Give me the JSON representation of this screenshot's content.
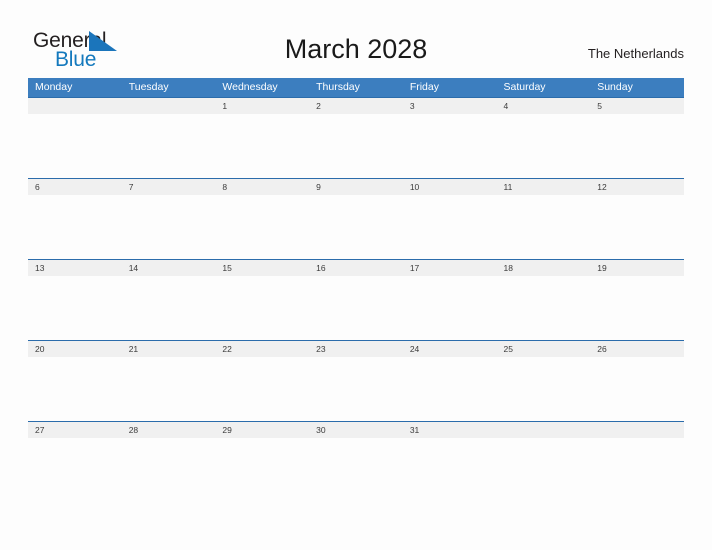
{
  "brand": {
    "word_one": "General",
    "word_two": "Blue",
    "triangle_icon": "triangle-icon",
    "accent_color": "#1b75bb"
  },
  "header": {
    "title": "March 2028",
    "region": "The Netherlands"
  },
  "theme": {
    "header_blue": "#3c7ebf",
    "row_line_blue": "#2b6cab",
    "date_band_gray": "#f0f0f0",
    "page_background": "#fdfdfd",
    "text_dark": "#231f20"
  },
  "calendar": {
    "weekday_headers": [
      "Monday",
      "Tuesday",
      "Wednesday",
      "Thursday",
      "Friday",
      "Saturday",
      "Sunday"
    ],
    "weeks": [
      [
        "",
        "",
        "1",
        "2",
        "3",
        "4",
        "5"
      ],
      [
        "6",
        "7",
        "8",
        "9",
        "10",
        "11",
        "12"
      ],
      [
        "13",
        "14",
        "15",
        "16",
        "17",
        "18",
        "19"
      ],
      [
        "20",
        "21",
        "22",
        "23",
        "24",
        "25",
        "26"
      ],
      [
        "27",
        "28",
        "29",
        "30",
        "31",
        "",
        ""
      ]
    ]
  }
}
